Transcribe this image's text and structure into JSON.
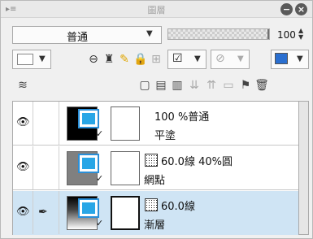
{
  "panel": {
    "title": "圖層",
    "minimize_glyph": "−",
    "close_glyph": "×"
  },
  "blend": {
    "value": "普通",
    "arrow": "▼"
  },
  "opacity": {
    "value": "100",
    "percent": 100,
    "spin_up": "▲",
    "spin_down": "▼"
  },
  "toolbar": {
    "icons": [
      "layer-color-icon",
      "clip-icon",
      "reference-icon",
      "draft-icon",
      "lock-icon",
      "lock-alpha-icon",
      "mask-toggle-icon",
      "ruler-toggle-icon",
      "color-mode-icon"
    ]
  },
  "layer_tools": {
    "icons": [
      "new-raster-icon",
      "new-vector-icon",
      "new-folder-icon",
      "transfer-down-icon",
      "merge-down-icon",
      "mask-icon",
      "ruler-icon",
      "delete-icon"
    ]
  },
  "layers": [
    {
      "line1": "100 %普通",
      "line2": "平塗",
      "visible": true,
      "has_pen": false,
      "has_tone_icon": false,
      "selected": false,
      "thumb_color": "#000000"
    },
    {
      "line1": "60.0線 40%圓",
      "line2": "網點",
      "visible": true,
      "has_pen": false,
      "has_tone_icon": true,
      "selected": false,
      "thumb_color": "#808080"
    },
    {
      "line1": "60.0線",
      "line2": "漸層",
      "visible": true,
      "has_pen": true,
      "has_tone_icon": true,
      "selected": true,
      "thumb_color": "gradient"
    }
  ],
  "colors": {
    "selected_row": "#cfe4f4",
    "accent_blue": "#29a6e6"
  }
}
